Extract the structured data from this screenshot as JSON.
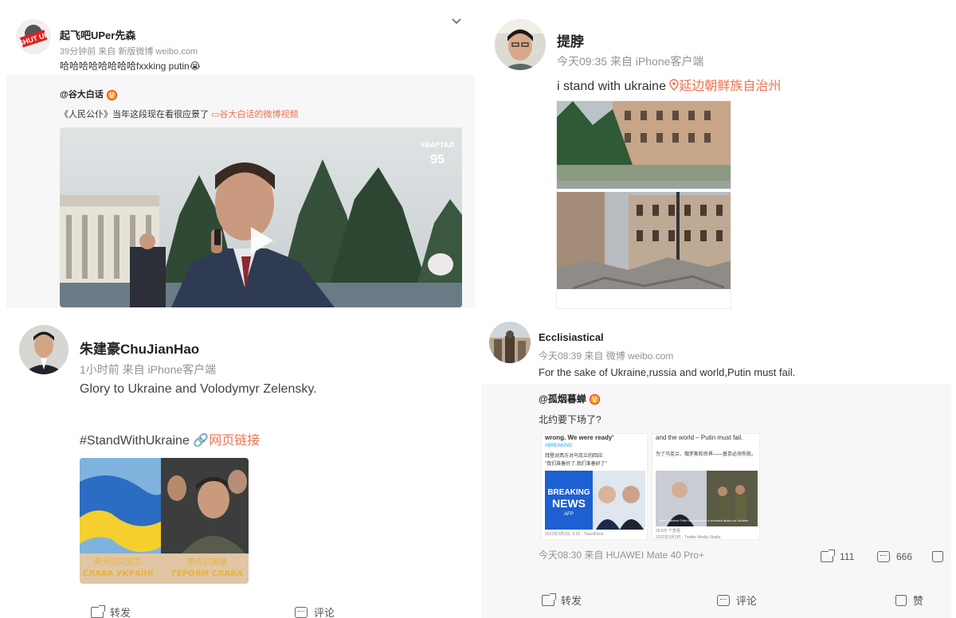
{
  "colors": {
    "link": "#eb7350",
    "meta": "#939393",
    "text": "#333333"
  },
  "post_tl": {
    "avatar_text": "SHUT UP",
    "author": "起飞吧UPer先森",
    "meta": "39分钟前  来自 新版微博 weibo.com",
    "text": "哈哈哈哈哈哈哈哈fxxking putin😭",
    "repost_author": "@谷大白话",
    "repost_text": "《人民公仆》当年这段现在看很应景了",
    "repost_link": "谷大白话的微博视频",
    "video_logo_top": "КВАРТАЛ",
    "video_logo_bottom": "95",
    "menu_icon": "chevron-down-icon",
    "actions": {
      "share": "转发",
      "comment": "评论"
    }
  },
  "post_tr": {
    "author": "提脖",
    "meta": "今天09:35  来自 iPhone客户端",
    "text": "i stand with ukraine",
    "location_icon": "location-pin-icon",
    "location": "延边朝鲜族自治州"
  },
  "post_bl": {
    "author": "朱建豪ChuJianHao",
    "meta": "1小时前  来自 iPhone客户端",
    "text1": "Glory to Ukraine and Volodymyr Zelensky.",
    "hashtag": "#StandWithUkraine",
    "link_icon": "link-icon",
    "link": "网页链接",
    "caption_left_cn": "荣光归乌克兰",
    "caption_left": "СЛАВА УКРАЇНІ",
    "caption_right_cn": "荣光归英雄",
    "caption_right": "ГЕРОЯМ СЛАВА",
    "actions": {
      "share": "转发",
      "comment": "评论"
    }
  },
  "post_br": {
    "author": "Ecclisiastical",
    "meta": "今天08:39  来自 微博 weibo.com",
    "text": "For the sake of Ukraine,russia and world,Putin must fail.",
    "repost_author": "@孤烟暮蝉",
    "repost_text": "北约要下场了?",
    "card1_head": "wrong. We were ready'",
    "card1_breaking": "#BREAKING",
    "card1_cn_a": "拜登对西方对乌克兰的回应:",
    "card1_cn_b": "\"我们准备好了,我们准备好了\"",
    "card1_news_top": "BREAKING",
    "card1_news_bottom": "NEWS",
    "card1_agency": "AFP",
    "card1_footer": "2022年3月3日, 6:33 · TweetDeck",
    "card2_head": "and the world – Putin must fail.",
    "card2_cn": "为了乌克兰、俄罗斯和世界——普京必须失败。",
    "card2_caption": "when Vladimir Putin has launched a renewed attack on Ukraine",
    "card2_footer": "2022年3月3日 · Twitter Media Studio",
    "card2_stats": "26.8万 个查看",
    "repost_meta": "今天08:30  来自 HUAWEI Mate 40 Pro+",
    "share_count": "111",
    "comment_count": "666",
    "actions": {
      "share": "转发",
      "comment": "评论",
      "like": "赞"
    }
  }
}
